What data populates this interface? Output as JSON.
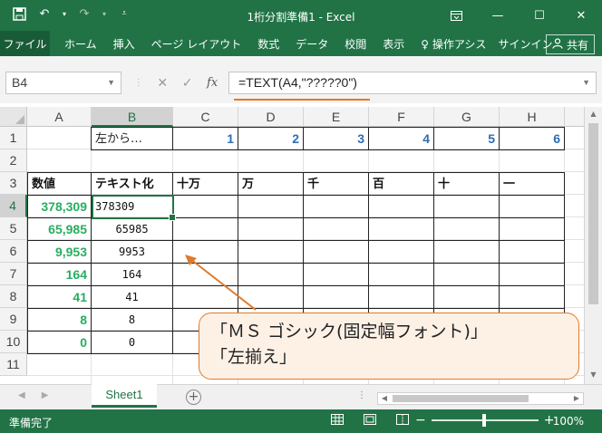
{
  "app": {
    "title": "1桁分割準備1 - Excel",
    "colors": {
      "brand": "#217346",
      "number_green": "#27ae60",
      "number_blue": "#2f6db4",
      "callout_border": "#e07b2a"
    }
  },
  "qat": {
    "save_icon": "save-icon",
    "undo_icon": "undo-icon",
    "redo_icon": "redo-icon",
    "customize_icon": "customize-icon"
  },
  "window": {
    "ribbon_display_icon": "ribbon-display-icon",
    "minimize_icon": "minimize-icon",
    "maximize_icon": "maximize-icon",
    "close_icon": "close-icon"
  },
  "ribbon": {
    "file": "ファイル",
    "tabs": [
      "ホーム",
      "挿入",
      "ページ レイアウト",
      "数式",
      "データ",
      "校閲",
      "表示"
    ],
    "tell_me": "操作アシス",
    "signin": "サインイン",
    "share": "共有"
  },
  "formula_bar": {
    "name_box": "B4",
    "formula": "=TEXT(A4,\"?????0\")",
    "fx": "fx"
  },
  "columns": [
    "A",
    "B",
    "C",
    "D",
    "E",
    "F",
    "G",
    "H"
  ],
  "rows": [
    "1",
    "2",
    "3",
    "4",
    "5",
    "6",
    "7",
    "8",
    "9",
    "10",
    "11"
  ],
  "selected": {
    "column": "B",
    "row": "4"
  },
  "cells": {
    "B1": "左から…",
    "C1": "1",
    "D1": "2",
    "E1": "3",
    "F1": "4",
    "G1": "5",
    "H1": "6",
    "A3": "数値",
    "B3": "テキスト化",
    "C3": "十万",
    "D3": "万",
    "E3": "千",
    "F3": "百",
    "G3": "十",
    "H3": "一",
    "A4": "378,309",
    "A5": "65,985",
    "A6": "9,953",
    "A7": "164",
    "A8": "41",
    "A9": "8",
    "A10": "0",
    "B4": "378309",
    "B5": "65985",
    "B6": "9953",
    "B7": "164",
    "B8": "41",
    "B9": "8",
    "B10": "0"
  },
  "callout": {
    "line1": "「ＭＳ ゴシック(固定幅フォント)」",
    "line2": "「左揃え」"
  },
  "sheet_tabs": {
    "active": "Sheet1"
  },
  "status": {
    "text": "準備完了",
    "zoom": "100%"
  }
}
